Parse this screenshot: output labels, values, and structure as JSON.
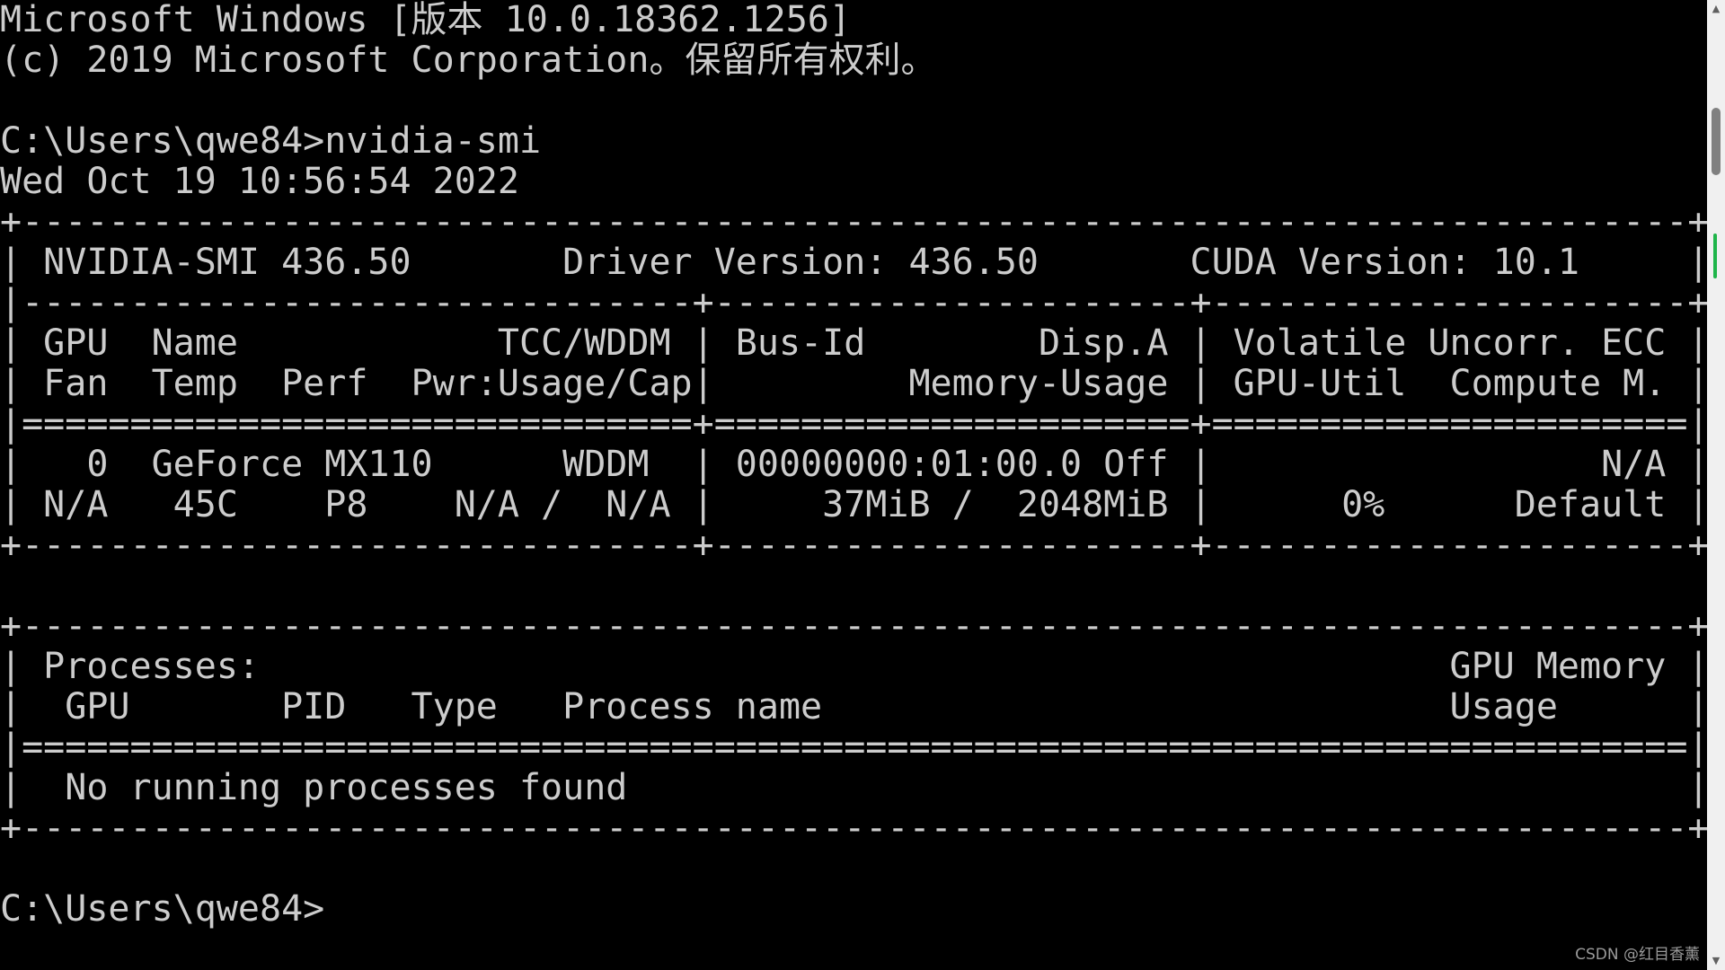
{
  "terminal": {
    "header": {
      "os_version": "Microsoft Windows [版本 10.0.18362.1256]",
      "copyright": "(c) 2019 Microsoft Corporation。保留所有权利。"
    },
    "command_line": "C:\\Users\\qwe84>nvidia-smi",
    "timestamp": "Wed Oct 19 10:56:54 2022",
    "smi": {
      "border_top": "+-----------------------------------------------------------------------------+",
      "version_row": "| NVIDIA-SMI 436.50       Driver Version: 436.50       CUDA Version: 10.1     |",
      "separator_1": "|-------------------------------+----------------------+----------------------+",
      "col_header_1": "| GPU  Name            TCC/WDDM | Bus-Id        Disp.A | Volatile Uncorr. ECC |",
      "col_header_2": "| Fan  Temp  Perf  Pwr:Usage/Cap|         Memory-Usage | GPU-Util  Compute M. |",
      "separator_2": "|===============================+======================+======================|",
      "gpu_row_1": "|   0  GeForce MX110      WDDM  | 00000000:01:00.0 Off |                  N/A |",
      "gpu_row_2": "| N/A   45C    P8    N/A /  N/A |     37MiB /  2048MiB |      0%      Default |",
      "border_bottom": "+-------------------------------+----------------------+----------------------+",
      "proc_border_top": "+-----------------------------------------------------------------------------+",
      "proc_header_1": "| Processes:                                                       GPU Memory |",
      "proc_header_2": "|  GPU       PID   Type   Process name                             Usage      |",
      "proc_separator": "|=============================================================================|",
      "proc_none": "|  No running processes found                                                 |",
      "proc_border_bottom": "+-----------------------------------------------------------------------------+"
    },
    "prompt": "C:\\Users\\qwe84>"
  },
  "watermark": "CSDN @红目香薰",
  "scrollbar": {
    "up_icon": "▲",
    "down_icon": "▼",
    "marker_color": "#1fb54a"
  }
}
